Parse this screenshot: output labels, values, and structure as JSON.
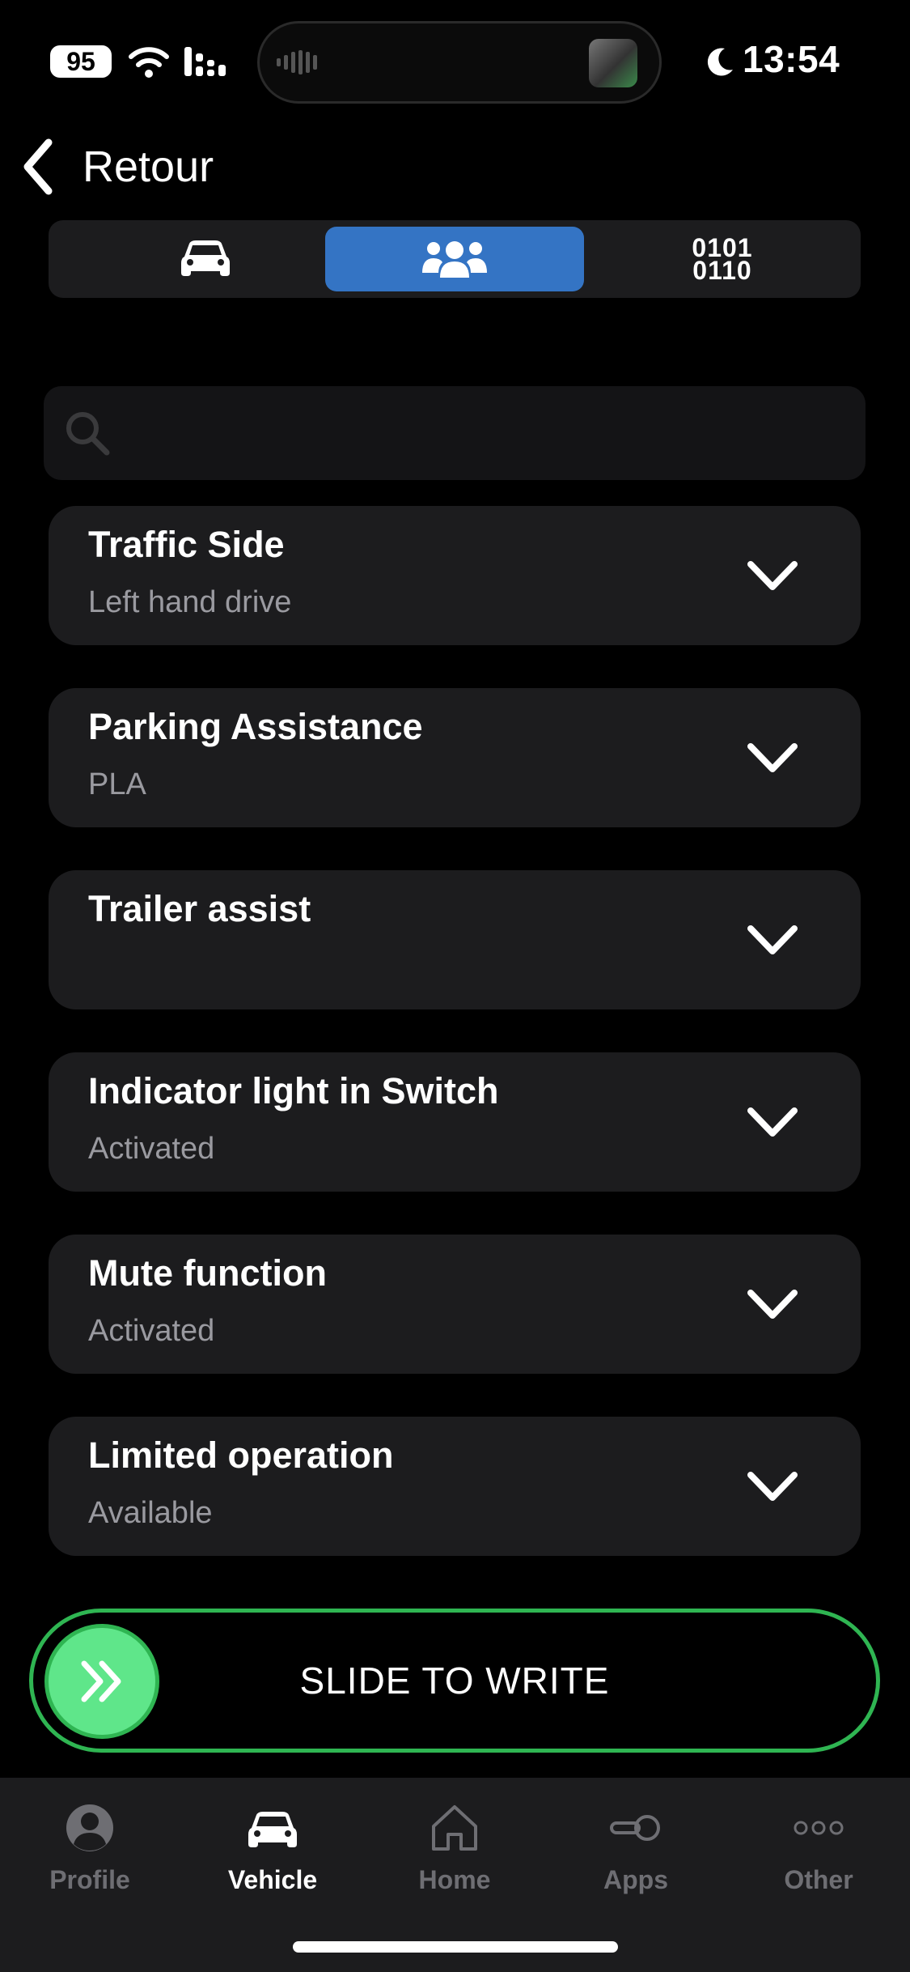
{
  "status_bar": {
    "battery": "95",
    "time": "13:54",
    "icons": [
      "battery-icon",
      "wifi-icon",
      "cellular-signal-icon",
      "audio-wave-icon",
      "moon-icon"
    ]
  },
  "nav": {
    "back_label": "Retour",
    "back_icon": "chevron-left-icon"
  },
  "segmented": {
    "options": [
      {
        "icon": "car-icon",
        "selected": false
      },
      {
        "icon": "people-icon",
        "selected": true
      },
      {
        "icon": "binary-code-icon",
        "text_top": "0101",
        "text_bottom": "0110",
        "selected": false
      }
    ],
    "active_color": "#3474c4"
  },
  "search": {
    "placeholder": "",
    "value": "",
    "icon": "search-icon"
  },
  "settings": [
    {
      "title": "Traffic Side",
      "value": "Left hand drive"
    },
    {
      "title": "Parking Assistance",
      "value": "PLA"
    },
    {
      "title": "Trailer assist",
      "value": ""
    },
    {
      "title": "Indicator light in Switch",
      "value": "Activated"
    },
    {
      "title": "Mute function",
      "value": "Activated"
    },
    {
      "title": "Limited operation",
      "value": "Available"
    }
  ],
  "slide_action": {
    "label": "SLIDE TO WRITE",
    "icon": "double-chevron-right-icon",
    "accent": "#2fb552",
    "knob_color": "#5fe68a"
  },
  "tab_bar": {
    "tabs": [
      {
        "label": "Profile",
        "icon": "profile-icon",
        "active": false
      },
      {
        "label": "Vehicle",
        "icon": "car-icon",
        "active": true
      },
      {
        "label": "Home",
        "icon": "home-icon",
        "active": false
      },
      {
        "label": "Apps",
        "icon": "toggle-icon",
        "active": false
      },
      {
        "label": "Other",
        "icon": "more-icon",
        "active": false
      }
    ]
  }
}
